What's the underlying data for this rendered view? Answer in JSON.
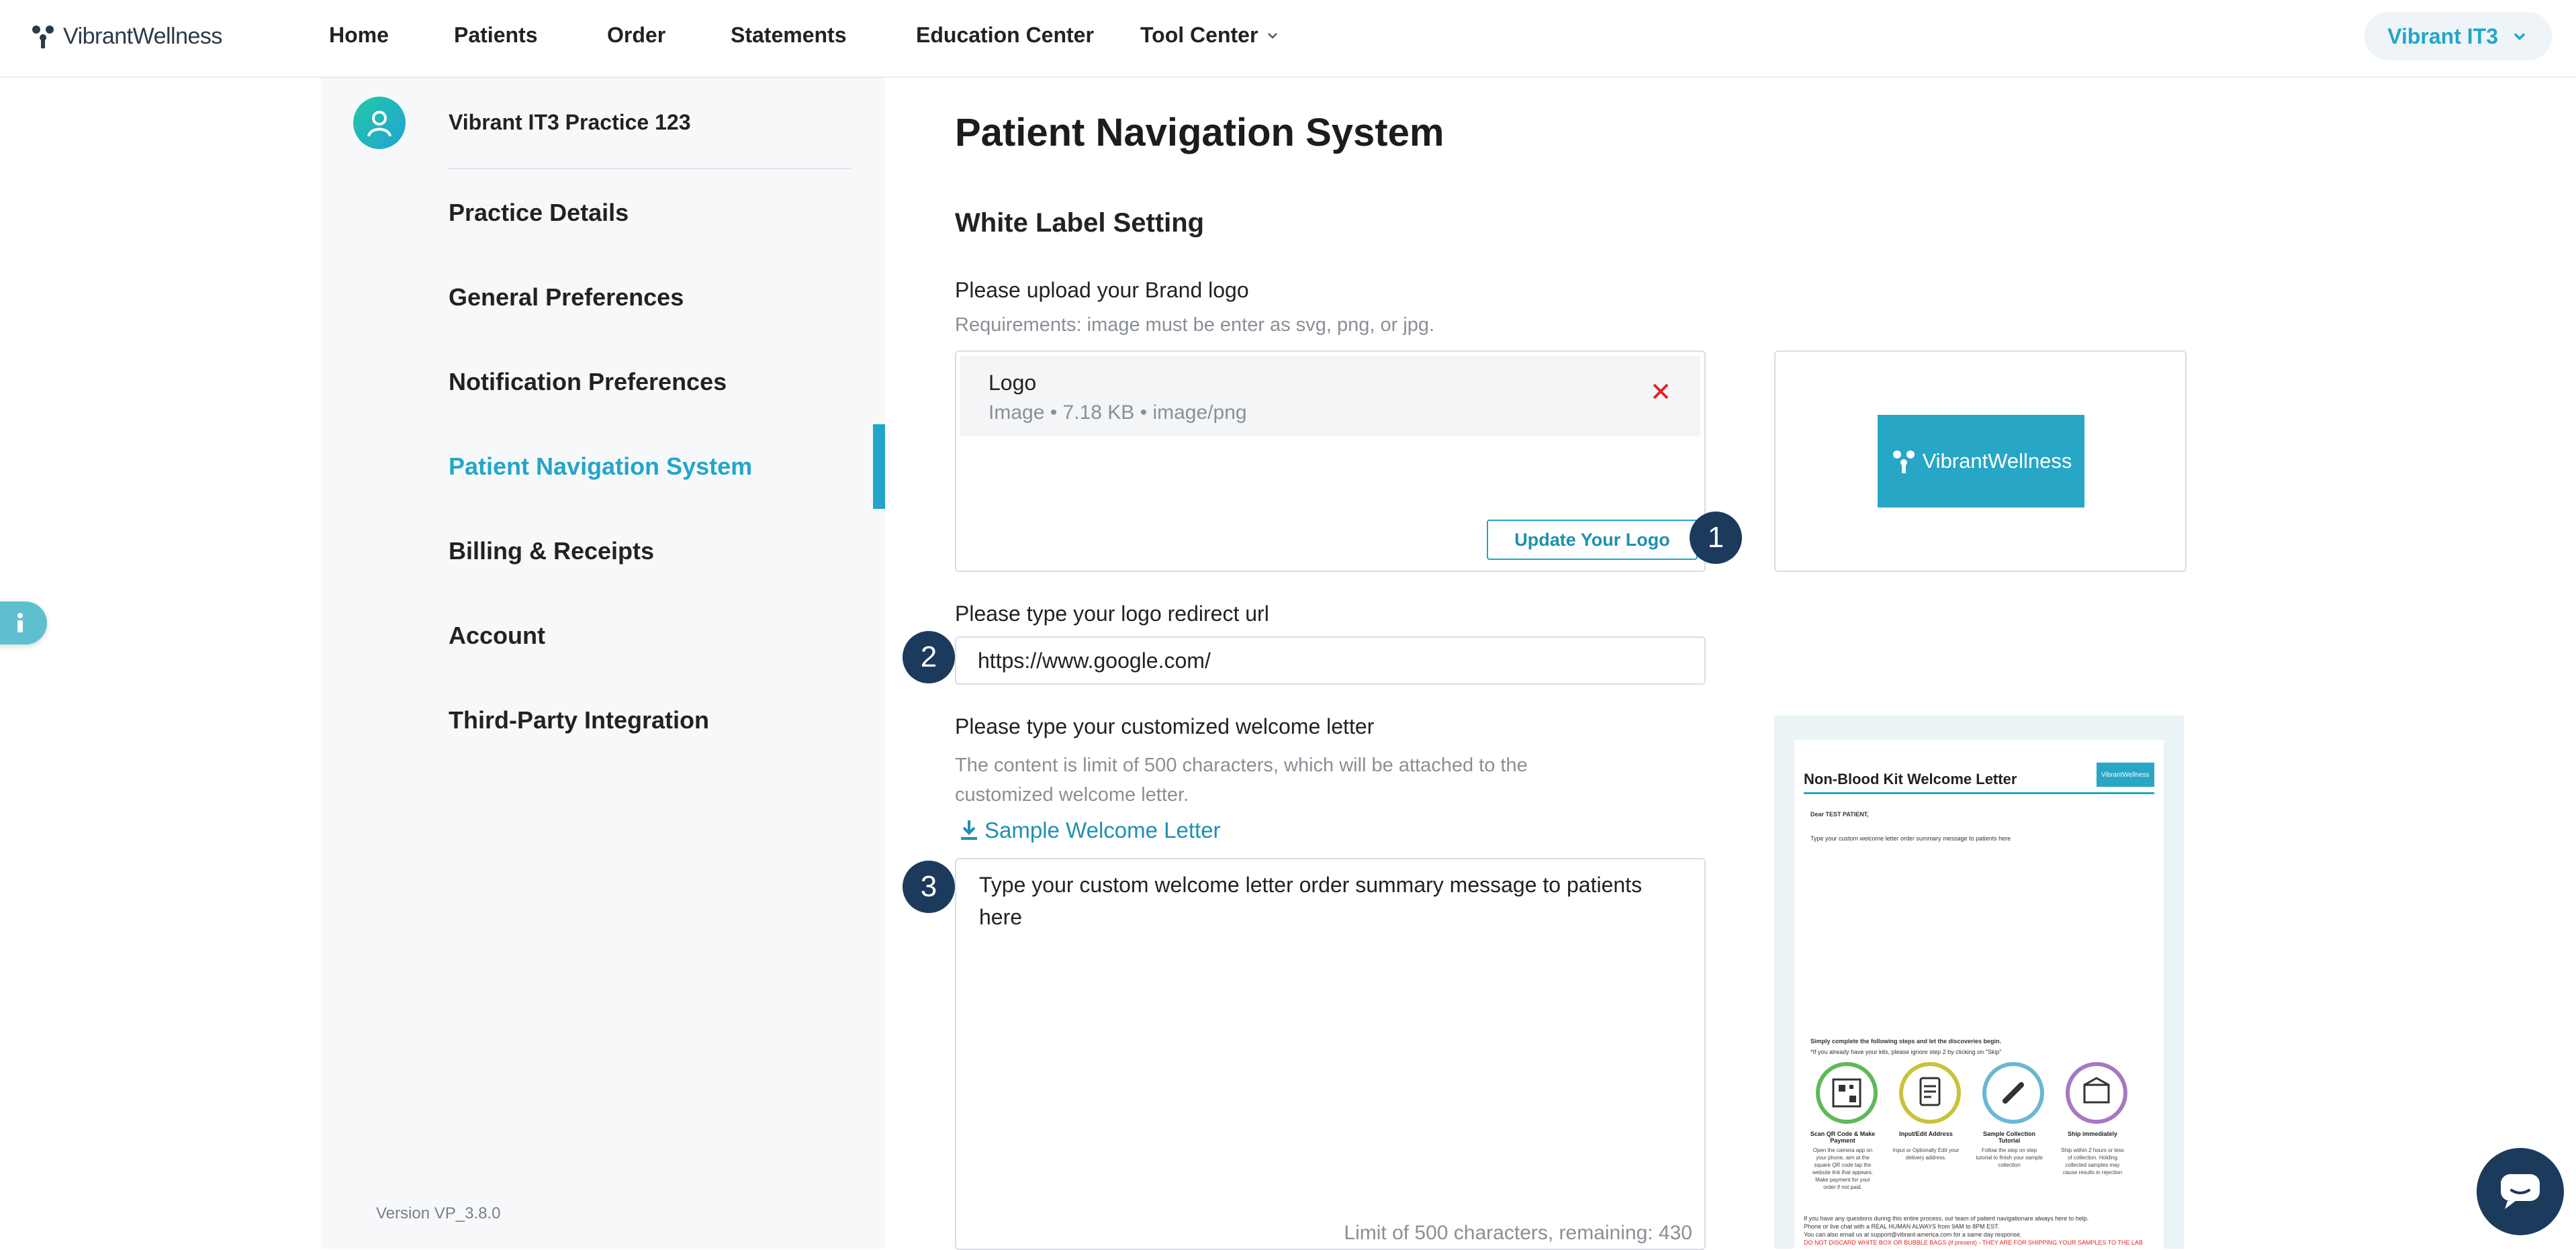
{
  "header": {
    "brand": "VibrantWellness",
    "nav": [
      "Home",
      "Patients",
      "Order",
      "Statements",
      "Education Center",
      "Tool Center"
    ],
    "user": "Vibrant IT3"
  },
  "sidebar": {
    "practice_name": "Vibrant IT3 Practice 123",
    "items": [
      "Practice Details",
      "General Preferences",
      "Notification Preferences",
      "Patient Navigation System",
      "Billing & Receipts",
      "Account",
      "Third-Party Integration"
    ],
    "active": "Patient Navigation System",
    "version": "Version VP_3.8.0"
  },
  "main": {
    "title": "Patient Navigation System",
    "section": "White Label Setting",
    "logo": {
      "label": "Please upload your Brand logo",
      "hint": "Requirements: image must be enter as svg, png, or jpg.",
      "file_name": "Logo",
      "file_meta": "Image • 7.18 KB • image/png",
      "update_button": "Update Your Logo",
      "preview_text": "VibrantWellness"
    },
    "url": {
      "label": "Please type your logo redirect url",
      "value": "https://www.google.com/"
    },
    "letter": {
      "label": "Please type your customized welcome letter",
      "hint": "The content is limit of 500 characters, which will be attached to the customized welcome letter.",
      "sample_link": "Sample Welcome Letter",
      "value": "Type your custom welcome letter order summary message to patients here",
      "counter": "Limit of 500 characters, remaining: 430"
    },
    "badges": [
      "1",
      "2",
      "3"
    ]
  },
  "letter_preview": {
    "title": "Non-Blood Kit Welcome Letter",
    "logo": "VibrantWellness",
    "dear": "Dear TEST PATIENT,",
    "body": "Type your custom welcome letter order summary message to patients here",
    "steps_intro": "Simply complete the following steps and let the discoveries begin.",
    "steps_note": "*If you already have your kits, please ignore step 2 by clicking on \"Skip\"",
    "steps": [
      {
        "title": "Scan QR Code & Make Payment",
        "text": "Open the camera app on your phone, aim at the square QR code tap the website link that appears. Make payment for your order if not paid."
      },
      {
        "title": "Input/Edit Address",
        "text": "Input or Optionally Edit your delivery address."
      },
      {
        "title": "Sample Collection Tutorial",
        "text": "Follow the step on step tutorial to finish your sample collection"
      },
      {
        "title": "Ship immediately",
        "text": "Ship within 2 hours or less of collection. Holding collected samples may cause results in rejection"
      }
    ],
    "footer": [
      "If you have any questions during this entire process, our team of patient navigationare always here to help.",
      "Phone or live chat with a REAL HUMAN ALWAYS from 9AM to 8PM EST.",
      "You can also email us at support@vibrant-america.com for a same day response.",
      "DO NOT DISCARD WHITE BOX OR BUBBLE BAGS (if present) - THEY ARE FOR SHIPPING YOUR SAMPLES TO THE LAB"
    ]
  }
}
